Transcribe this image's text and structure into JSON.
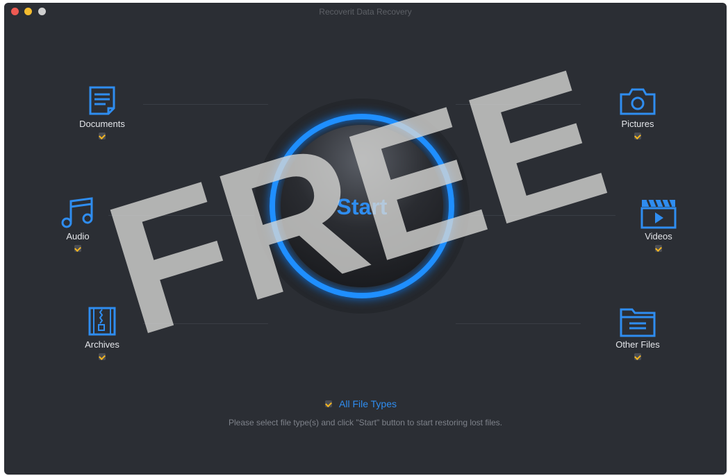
{
  "window": {
    "title": "Recoverit Data Recovery"
  },
  "start": {
    "label": "Start"
  },
  "categories": {
    "documents": {
      "label": "Documents",
      "checked": true
    },
    "audio": {
      "label": "Audio",
      "checked": true
    },
    "archives": {
      "label": "Archives",
      "checked": true
    },
    "pictures": {
      "label": "Pictures",
      "checked": true
    },
    "videos": {
      "label": "Videos",
      "checked": true
    },
    "other": {
      "label": "Other Files",
      "checked": true
    }
  },
  "all_file_types": {
    "label": "All File Types",
    "checked": true
  },
  "hint": "Please select file type(s) and click \"Start\" button to start restoring lost files.",
  "watermark": {
    "text": "FREE"
  },
  "colors": {
    "accent": "#1f8fff",
    "check": "#f3b521",
    "background": "#2b2e34"
  }
}
